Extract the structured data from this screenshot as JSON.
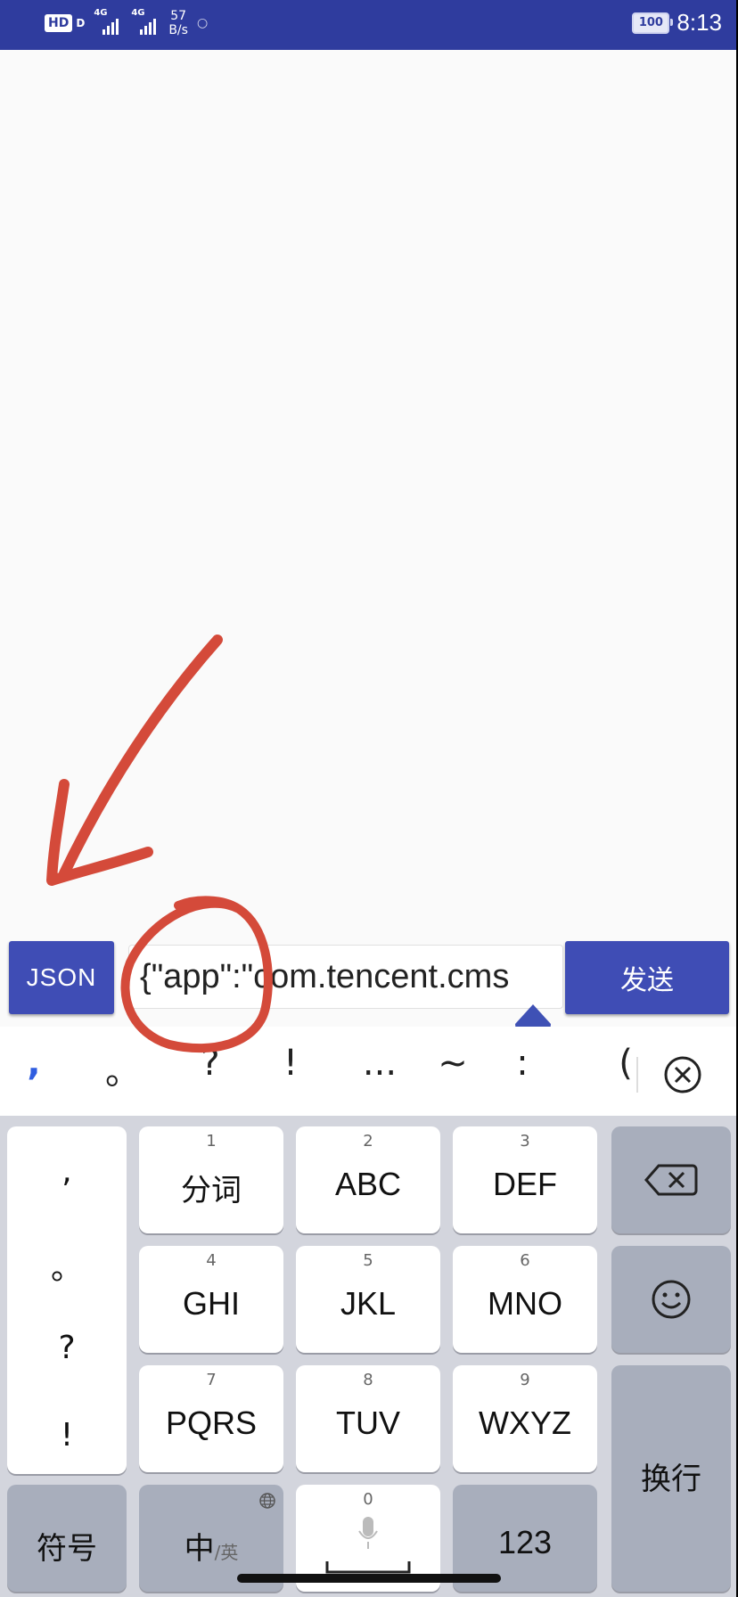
{
  "status_bar": {
    "hd_label": "HD",
    "hd_sub": "D",
    "signal1_label": "4G",
    "signal2_label": "4G",
    "net_speed_value": "57",
    "net_speed_unit": "B/s",
    "battery": "100",
    "time": "8:13"
  },
  "input_row": {
    "json_button_label": "JSON",
    "message_value": "{\"app\":\"com.tencent.cms",
    "send_button_label": "发送"
  },
  "punctuation_bar": {
    "items": [
      ",",
      "。",
      "?",
      "!",
      "...",
      "~",
      ":",
      "("
    ]
  },
  "keyboard": {
    "side_punct": [
      ",",
      "。",
      "?",
      "!"
    ],
    "keys": [
      {
        "num": "1",
        "label": "分词"
      },
      {
        "num": "2",
        "label": "ABC"
      },
      {
        "num": "3",
        "label": "DEF"
      },
      {
        "num": "4",
        "label": "GHI"
      },
      {
        "num": "5",
        "label": "JKL"
      },
      {
        "num": "6",
        "label": "MNO"
      },
      {
        "num": "7",
        "label": "PQRS"
      },
      {
        "num": "8",
        "label": "TUV"
      },
      {
        "num": "9",
        "label": "WXYZ"
      }
    ],
    "symbols_label": "符号",
    "lang_main": "中",
    "lang_sub": "/英",
    "space_num": "0",
    "numbers_label": "123",
    "enter_label": "换行"
  },
  "icons": {
    "delete": "backspace-icon",
    "emoji": "emoji-icon",
    "close": "close-circle-icon",
    "mic": "mic-icon",
    "globe": "globe-icon"
  },
  "colors": {
    "primary": "#3f4db5",
    "status_bar": "#2f3c9e",
    "annotation": "#d44a3a",
    "caret_handle": "#3f51b5"
  }
}
